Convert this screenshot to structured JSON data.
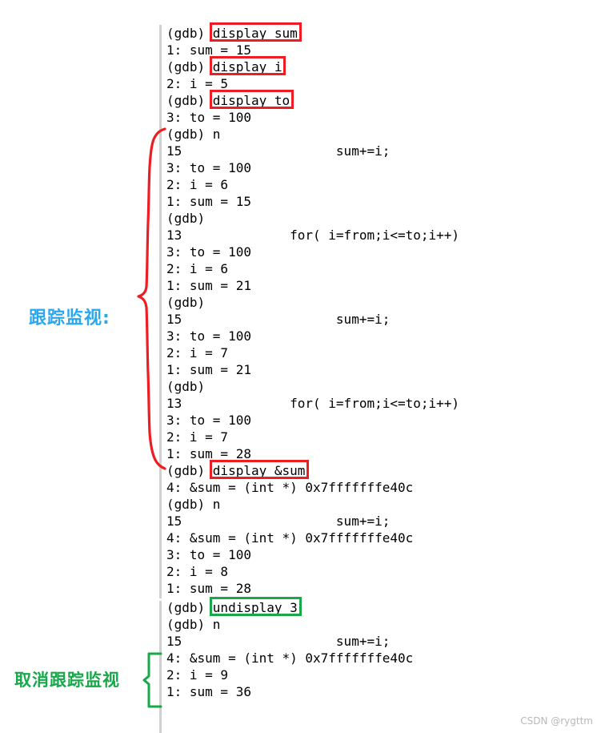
{
  "meta": {
    "background_color": "#ffffff",
    "text_color": "#000000",
    "accent_red": "#ee1c23",
    "accent_green": "#17a84a",
    "accent_blue": "#29a8f0",
    "gutter_color": "#d0d0d0"
  },
  "watermark": {
    "text": "CSDN @rygttm"
  },
  "annotations": {
    "track": {
      "label": "跟踪监视:",
      "color": "#29a8f0",
      "brace_color": "#ee1c23"
    },
    "untrack": {
      "label": "取消跟踪监视",
      "color": "#17a84a",
      "brace_color": "#17a84a"
    }
  },
  "highlights": [
    {
      "name": "display-sum",
      "command": "display sum",
      "color": "#ee1c23",
      "line_index": 0
    },
    {
      "name": "display-i",
      "command": "display i",
      "color": "#ee1c23",
      "line_index": 2
    },
    {
      "name": "display-to",
      "command": "display to",
      "color": "#ee1c23",
      "line_index": 4
    },
    {
      "name": "display-amp-sum",
      "command": "display &sum",
      "color": "#ee1c23",
      "line_index": 26
    },
    {
      "name": "undisplay-3",
      "command": "undisplay 3",
      "color": "#17a84a",
      "line_index": 34
    }
  ],
  "terminal": {
    "prompt": "(gdb)",
    "lines": [
      "(gdb) display sum",
      "1: sum = 15",
      "(gdb) display i",
      "2: i = 5",
      "(gdb) display to",
      "3: to = 100",
      "(gdb) n",
      "15                    sum+=i;",
      "3: to = 100",
      "2: i = 6",
      "1: sum = 15",
      "(gdb)",
      "13              for( i=from;i<=to;i++)",
      "3: to = 100",
      "2: i = 6",
      "1: sum = 21",
      "(gdb)",
      "15                    sum+=i;",
      "3: to = 100",
      "2: i = 7",
      "1: sum = 21",
      "(gdb)",
      "13              for( i=from;i<=to;i++)",
      "3: to = 100",
      "2: i = 7",
      "1: sum = 28",
      "(gdb) display &sum",
      "4: &sum = (int *) 0x7fffffffe40c",
      "(gdb) n",
      "15                    sum+=i;",
      "4: &sum = (int *) 0x7fffffffe40c",
      "3: to = 100",
      "2: i = 8",
      "1: sum = 28",
      "(gdb) undisplay 3",
      "(gdb) n",
      "15                    sum+=i;",
      "4: &sum = (int *) 0x7fffffffe40c",
      "2: i = 9",
      "1: sum = 36"
    ]
  }
}
